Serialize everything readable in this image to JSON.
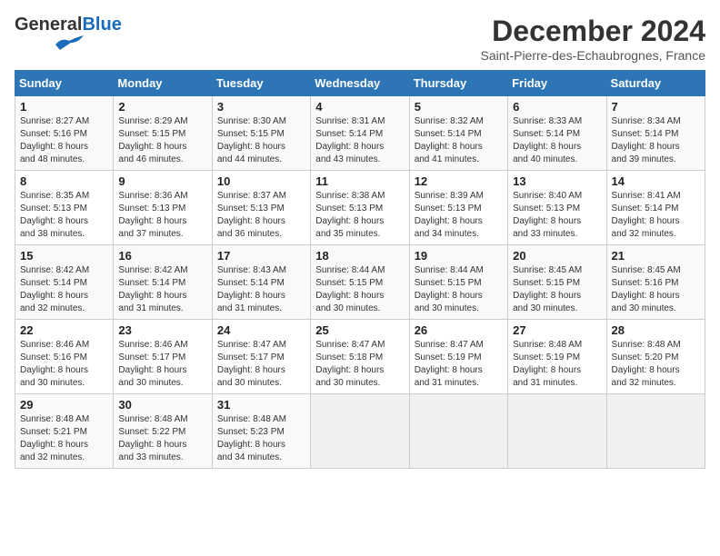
{
  "header": {
    "logo_general": "General",
    "logo_blue": "Blue",
    "month_title": "December 2024",
    "subtitle": "Saint-Pierre-des-Echaubrognes, France"
  },
  "columns": [
    "Sunday",
    "Monday",
    "Tuesday",
    "Wednesday",
    "Thursday",
    "Friday",
    "Saturday"
  ],
  "weeks": [
    [
      {
        "day": "1",
        "info": "Sunrise: 8:27 AM\nSunset: 5:16 PM\nDaylight: 8 hours\nand 48 minutes."
      },
      {
        "day": "2",
        "info": "Sunrise: 8:29 AM\nSunset: 5:15 PM\nDaylight: 8 hours\nand 46 minutes."
      },
      {
        "day": "3",
        "info": "Sunrise: 8:30 AM\nSunset: 5:15 PM\nDaylight: 8 hours\nand 44 minutes."
      },
      {
        "day": "4",
        "info": "Sunrise: 8:31 AM\nSunset: 5:14 PM\nDaylight: 8 hours\nand 43 minutes."
      },
      {
        "day": "5",
        "info": "Sunrise: 8:32 AM\nSunset: 5:14 PM\nDaylight: 8 hours\nand 41 minutes."
      },
      {
        "day": "6",
        "info": "Sunrise: 8:33 AM\nSunset: 5:14 PM\nDaylight: 8 hours\nand 40 minutes."
      },
      {
        "day": "7",
        "info": "Sunrise: 8:34 AM\nSunset: 5:14 PM\nDaylight: 8 hours\nand 39 minutes."
      }
    ],
    [
      {
        "day": "8",
        "info": "Sunrise: 8:35 AM\nSunset: 5:13 PM\nDaylight: 8 hours\nand 38 minutes."
      },
      {
        "day": "9",
        "info": "Sunrise: 8:36 AM\nSunset: 5:13 PM\nDaylight: 8 hours\nand 37 minutes."
      },
      {
        "day": "10",
        "info": "Sunrise: 8:37 AM\nSunset: 5:13 PM\nDaylight: 8 hours\nand 36 minutes."
      },
      {
        "day": "11",
        "info": "Sunrise: 8:38 AM\nSunset: 5:13 PM\nDaylight: 8 hours\nand 35 minutes."
      },
      {
        "day": "12",
        "info": "Sunrise: 8:39 AM\nSunset: 5:13 PM\nDaylight: 8 hours\nand 34 minutes."
      },
      {
        "day": "13",
        "info": "Sunrise: 8:40 AM\nSunset: 5:13 PM\nDaylight: 8 hours\nand 33 minutes."
      },
      {
        "day": "14",
        "info": "Sunrise: 8:41 AM\nSunset: 5:14 PM\nDaylight: 8 hours\nand 32 minutes."
      }
    ],
    [
      {
        "day": "15",
        "info": "Sunrise: 8:42 AM\nSunset: 5:14 PM\nDaylight: 8 hours\nand 32 minutes."
      },
      {
        "day": "16",
        "info": "Sunrise: 8:42 AM\nSunset: 5:14 PM\nDaylight: 8 hours\nand 31 minutes."
      },
      {
        "day": "17",
        "info": "Sunrise: 8:43 AM\nSunset: 5:14 PM\nDaylight: 8 hours\nand 31 minutes."
      },
      {
        "day": "18",
        "info": "Sunrise: 8:44 AM\nSunset: 5:15 PM\nDaylight: 8 hours\nand 30 minutes."
      },
      {
        "day": "19",
        "info": "Sunrise: 8:44 AM\nSunset: 5:15 PM\nDaylight: 8 hours\nand 30 minutes."
      },
      {
        "day": "20",
        "info": "Sunrise: 8:45 AM\nSunset: 5:15 PM\nDaylight: 8 hours\nand 30 minutes."
      },
      {
        "day": "21",
        "info": "Sunrise: 8:45 AM\nSunset: 5:16 PM\nDaylight: 8 hours\nand 30 minutes."
      }
    ],
    [
      {
        "day": "22",
        "info": "Sunrise: 8:46 AM\nSunset: 5:16 PM\nDaylight: 8 hours\nand 30 minutes."
      },
      {
        "day": "23",
        "info": "Sunrise: 8:46 AM\nSunset: 5:17 PM\nDaylight: 8 hours\nand 30 minutes."
      },
      {
        "day": "24",
        "info": "Sunrise: 8:47 AM\nSunset: 5:17 PM\nDaylight: 8 hours\nand 30 minutes."
      },
      {
        "day": "25",
        "info": "Sunrise: 8:47 AM\nSunset: 5:18 PM\nDaylight: 8 hours\nand 30 minutes."
      },
      {
        "day": "26",
        "info": "Sunrise: 8:47 AM\nSunset: 5:19 PM\nDaylight: 8 hours\nand 31 minutes."
      },
      {
        "day": "27",
        "info": "Sunrise: 8:48 AM\nSunset: 5:19 PM\nDaylight: 8 hours\nand 31 minutes."
      },
      {
        "day": "28",
        "info": "Sunrise: 8:48 AM\nSunset: 5:20 PM\nDaylight: 8 hours\nand 32 minutes."
      }
    ],
    [
      {
        "day": "29",
        "info": "Sunrise: 8:48 AM\nSunset: 5:21 PM\nDaylight: 8 hours\nand 32 minutes."
      },
      {
        "day": "30",
        "info": "Sunrise: 8:48 AM\nSunset: 5:22 PM\nDaylight: 8 hours\nand 33 minutes."
      },
      {
        "day": "31",
        "info": "Sunrise: 8:48 AM\nSunset: 5:23 PM\nDaylight: 8 hours\nand 34 minutes."
      },
      {
        "day": "",
        "info": ""
      },
      {
        "day": "",
        "info": ""
      },
      {
        "day": "",
        "info": ""
      },
      {
        "day": "",
        "info": ""
      }
    ]
  ]
}
